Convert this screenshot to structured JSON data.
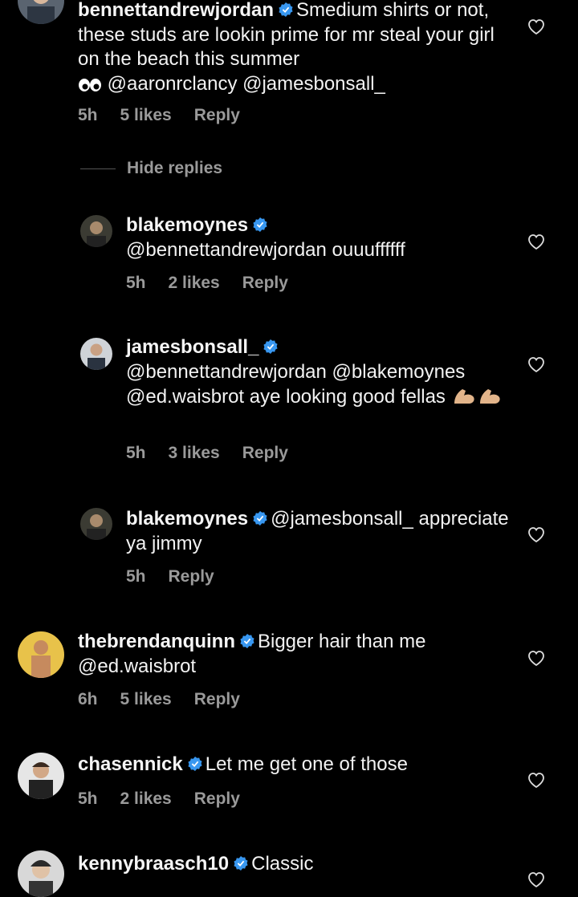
{
  "comments": [
    {
      "user": "bennettandrewjordan",
      "text": "Smedium shirts or not, these studs are lookin prime for mr steal your girl on the beach this summer",
      "tail": "@aaronrclancy @jamesbonsall_",
      "time": "5h",
      "likes": "5 likes",
      "reply": "Reply"
    },
    {
      "user": "blakemoynes",
      "text": "@bennettandrewjordan ouuuffffff",
      "time": "5h",
      "likes": "2 likes",
      "reply": "Reply"
    },
    {
      "user": "jamesbonsall_",
      "text": "@bennettandrewjordan @blakemoynes @ed.waisbrot aye looking good fellas",
      "time": "5h",
      "likes": "3 likes",
      "reply": "Reply"
    },
    {
      "user": "blakemoynes",
      "text": "@jamesbonsall_ appreciate ya jimmy",
      "time": "5h",
      "reply": "Reply"
    },
    {
      "user": "thebrendanquinn",
      "text": "Bigger hair than me @ed.waisbrot",
      "time": "6h",
      "likes": "5 likes",
      "reply": "Reply"
    },
    {
      "user": "chasennick",
      "text": "Let me get one of those",
      "time": "5h",
      "likes": "2 likes",
      "reply": "Reply"
    },
    {
      "user": "kennybraasch10",
      "text": "Classic"
    }
  ],
  "hide_replies": "Hide replies",
  "colors": {
    "verified": "#3897f0",
    "muted": "#9a9a9a",
    "background": "#000000"
  }
}
